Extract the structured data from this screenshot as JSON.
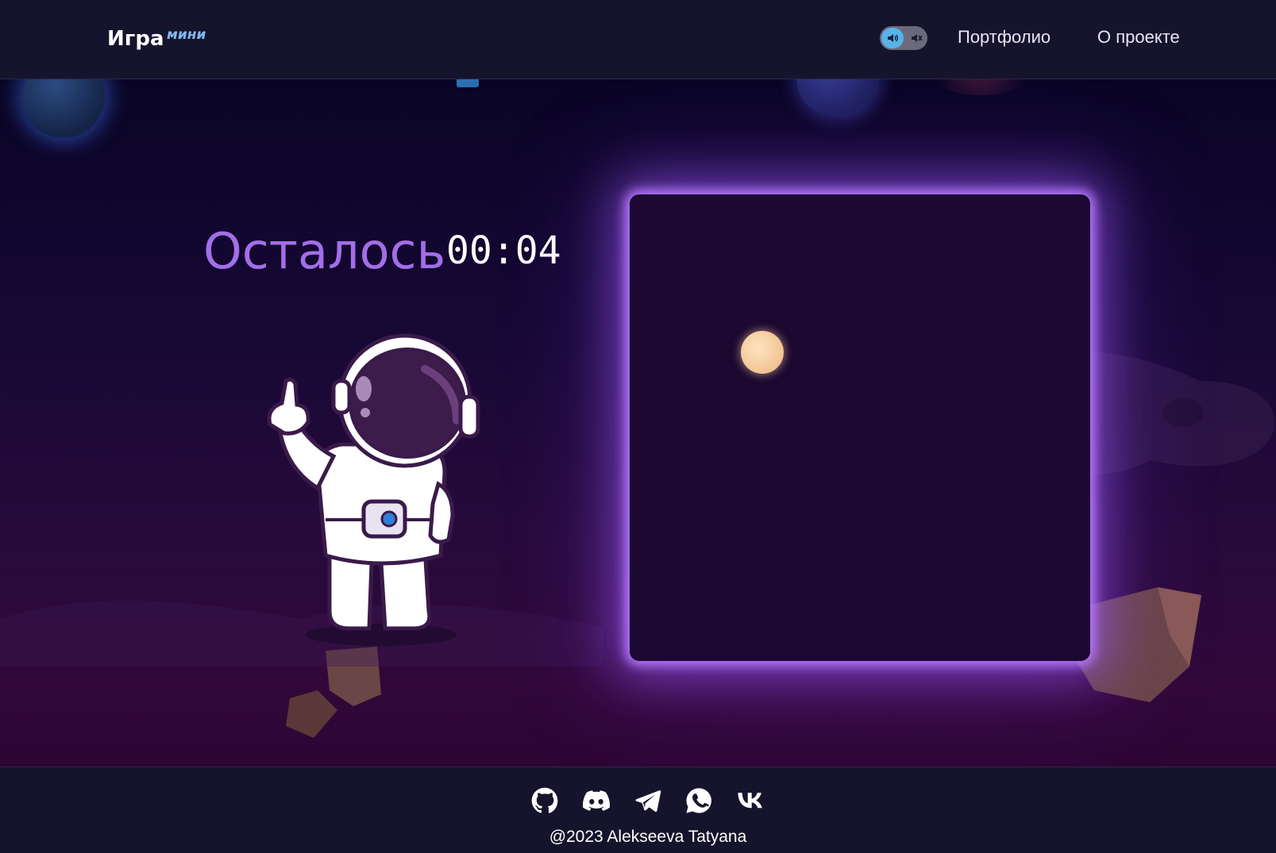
{
  "header": {
    "brand": "Игра",
    "brand_sub": "мини",
    "nav": [
      {
        "label": "Портфолио"
      },
      {
        "label": "О проекте"
      }
    ],
    "sound_toggle": {
      "on_icon": "speaker-on-icon",
      "off_icon": "speaker-muted-icon",
      "state": "on"
    }
  },
  "game": {
    "timer_label": "Осталось",
    "timer_value": "00:04"
  },
  "footer": {
    "socials": [
      "github-icon",
      "discord-icon",
      "telegram-icon",
      "whatsapp-icon",
      "vk-icon"
    ],
    "copyright": "@2023 Alekseeva Tatyana"
  },
  "colors": {
    "accent_purple": "#a36ee8",
    "glow": "#b779ff",
    "header_bg": "#16142d",
    "toggle_active": "#58b3e8",
    "brand_sub": "#7fb8ee"
  }
}
